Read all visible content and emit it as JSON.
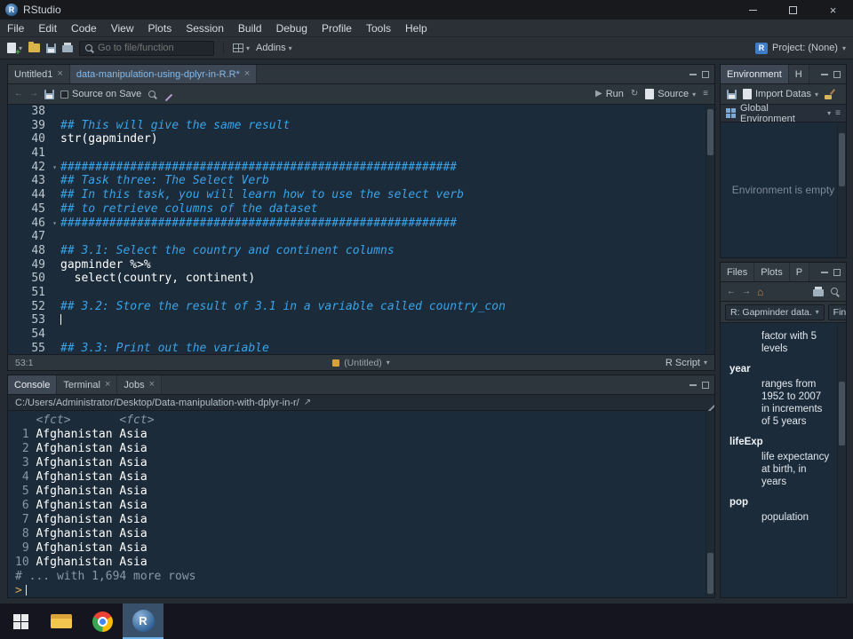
{
  "icon_glyphs": {
    "close": "×",
    "caret_down": "▾",
    "back": "←",
    "forward": "→",
    "run": "▶",
    "rerun": "↻",
    "home": "⌂",
    "popout": "↗",
    "list": "≡",
    "fold": "▾"
  },
  "titlebar": {
    "title": "RStudio",
    "logo_letter": "R"
  },
  "menu": [
    "File",
    "Edit",
    "Code",
    "View",
    "Plots",
    "Session",
    "Build",
    "Debug",
    "Profile",
    "Tools",
    "Help"
  ],
  "toolbar": {
    "goto_placeholder": "Go to file/function",
    "addins_label": "Addins",
    "project_label": "Project: (None)"
  },
  "editor": {
    "tabs": [
      {
        "label": "Untitled1",
        "closable": true
      },
      {
        "label": "data-manipulation-using-dplyr-in-R.R*",
        "active": true,
        "blue": true,
        "closable": true
      }
    ],
    "toolbar": {
      "source_on_save": "Source on Save",
      "run_label": "Run",
      "source_label": "Source"
    },
    "lines": [
      {
        "n": "38",
        "text": ""
      },
      {
        "n": "39",
        "text": "## This will give the same result",
        "comment": true
      },
      {
        "n": "40",
        "text": "str(gapminder)"
      },
      {
        "n": "41",
        "text": ""
      },
      {
        "n": "42",
        "text": "#########################################################",
        "comment": true,
        "fold": true
      },
      {
        "n": "43",
        "text": "## Task three: The Select Verb",
        "comment": true
      },
      {
        "n": "44",
        "text": "## In this task, you will learn how to use the select verb",
        "comment": true
      },
      {
        "n": "45",
        "text": "## to retrieve columns of the dataset",
        "comment": true
      },
      {
        "n": "46",
        "text": "#########################################################",
        "comment": true,
        "fold": true
      },
      {
        "n": "47",
        "text": ""
      },
      {
        "n": "48",
        "text": "## 3.1: Select the country and continent columns",
        "comment": true
      },
      {
        "n": "49",
        "text": "gapminder %>%"
      },
      {
        "n": "50",
        "text": "  select(country, continent)"
      },
      {
        "n": "51",
        "text": ""
      },
      {
        "n": "52",
        "text": "## 3.2: Store the result of 3.1 in a variable called country_con",
        "comment": true
      },
      {
        "n": "53",
        "text": "",
        "cursor": true
      },
      {
        "n": "54",
        "text": ""
      },
      {
        "n": "55",
        "text": "## 3.3: Print out the variable",
        "comment": true
      }
    ],
    "status": {
      "position": "53:1",
      "doc": "(Untitled)",
      "filetype": "R Script"
    }
  },
  "console": {
    "tabs": [
      {
        "label": "Console",
        "active": true
      },
      {
        "label": "Terminal",
        "closable": true
      },
      {
        "label": "Jobs",
        "closable": true
      }
    ],
    "path": "C:/Users/Administrator/Desktop/Data-manipulation-with-dplyr-in-r/",
    "header": "   <fct>       <fct>",
    "rows": [
      {
        "n": " 1 ",
        "text": "Afghanistan Asia"
      },
      {
        "n": " 2 ",
        "text": "Afghanistan Asia"
      },
      {
        "n": " 3 ",
        "text": "Afghanistan Asia"
      },
      {
        "n": " 4 ",
        "text": "Afghanistan Asia"
      },
      {
        "n": " 5 ",
        "text": "Afghanistan Asia"
      },
      {
        "n": " 6 ",
        "text": "Afghanistan Asia"
      },
      {
        "n": " 7 ",
        "text": "Afghanistan Asia"
      },
      {
        "n": " 8 ",
        "text": "Afghanistan Asia"
      },
      {
        "n": " 9 ",
        "text": "Afghanistan Asia"
      },
      {
        "n": "10 ",
        "text": "Afghanistan Asia"
      }
    ],
    "footer": "# ... with 1,694 more rows",
    "prompt": ">"
  },
  "environment": {
    "tabs": [
      {
        "label": "Environment",
        "active": true
      },
      {
        "label": "H"
      }
    ],
    "import_label": "Import Datas",
    "scope_label": "Global Environment",
    "empty_message": "Environment is empty"
  },
  "files": {
    "tabs": [
      {
        "label": "Files"
      },
      {
        "label": "Plots"
      },
      {
        "label": "P"
      }
    ],
    "help_topic": "R: Gapminder data.",
    "find_label": "Find",
    "entries": [
      {
        "term": "",
        "def": "factor with 5 levels"
      },
      {
        "term": "year",
        "def": "ranges from 1952 to 2007 in increments of 5 years"
      },
      {
        "term": "lifeExp",
        "def": "life expectancy at birth, in years"
      },
      {
        "term": "pop",
        "def": "population"
      }
    ]
  },
  "taskbar": {
    "rstudio_letter": "R"
  }
}
